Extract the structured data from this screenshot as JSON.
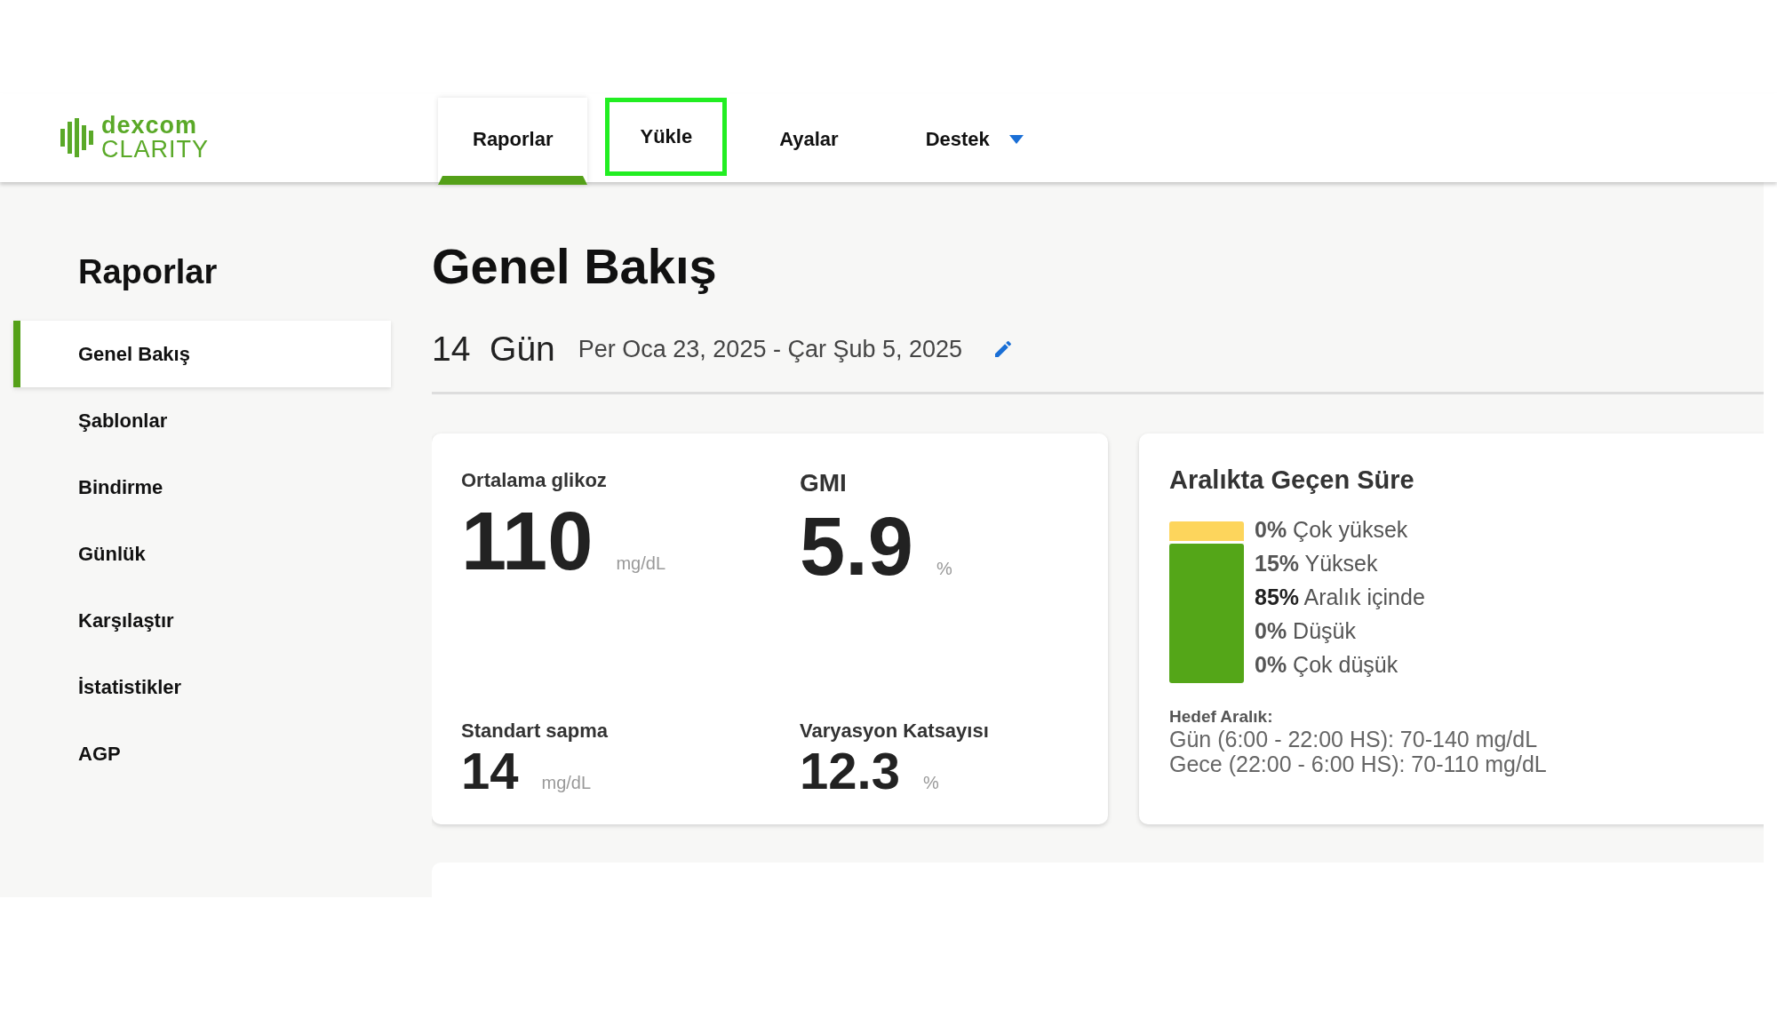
{
  "logo": {
    "line1": "dexcom",
    "line2": "CLARITY"
  },
  "nav": [
    {
      "label": "Raporlar",
      "selected": true,
      "outlined": false,
      "kind": "tab"
    },
    {
      "label": "Yükle",
      "selected": false,
      "outlined": true,
      "kind": "tab"
    },
    {
      "label": "Ayalar",
      "selected": false,
      "outlined": false,
      "kind": "tab"
    },
    {
      "label": "Destek",
      "selected": false,
      "outlined": false,
      "kind": "dropdown"
    }
  ],
  "sidebar": {
    "title": "Raporlar",
    "items": [
      {
        "label": "Genel Bakış",
        "selected": true
      },
      {
        "label": "Şablonlar",
        "selected": false
      },
      {
        "label": "Bindirme",
        "selected": false
      },
      {
        "label": "Günlük",
        "selected": false
      },
      {
        "label": "Karşılaştır",
        "selected": false
      },
      {
        "label": "İstatistikler",
        "selected": false
      },
      {
        "label": "AGP",
        "selected": false
      }
    ]
  },
  "page": {
    "title": "Genel Bakış",
    "days": "14",
    "days_unit": "Gün",
    "date_range": "Per Oca 23, 2025 - Çar Şub 5, 2025"
  },
  "stats": [
    {
      "label": "Ortalama glikoz",
      "value": "110",
      "unit": "mg/dL",
      "kind": "large"
    },
    {
      "label": "GMI",
      "value": "5.9",
      "unit": "%",
      "kind": "large"
    },
    {
      "label": "Standart sapma",
      "value": "14",
      "unit": "mg/dL",
      "kind": "small"
    },
    {
      "label": "Varyasyon Katsayısı",
      "value": "12.3",
      "unit": "%",
      "kind": "small"
    }
  ],
  "time_in_range": {
    "title": "Aralıkta Geçen Süre",
    "bar": [
      {
        "level": 0.14,
        "color": "#fdd55c"
      },
      {
        "level": 0.86,
        "color": "#54a618"
      }
    ],
    "ranges": [
      {
        "percent": "0%",
        "label": "Çok yüksek",
        "highlighted": false
      },
      {
        "percent": "15%",
        "label": "Yüksek",
        "highlighted": false
      },
      {
        "percent": "85%",
        "label": "Aralık içinde",
        "highlighted": true
      },
      {
        "percent": "0%",
        "label": "Düşük",
        "highlighted": false
      },
      {
        "percent": "0%",
        "label": "Çok düşük",
        "highlighted": false
      }
    ],
    "target_label": "Hedef Aralık:",
    "targets": [
      "Gün (6:00 - 22:00 HS): 70-140 mg/dL",
      "Gece (22:00 - 6:00 HS): 70-110 mg/dL"
    ]
  }
}
